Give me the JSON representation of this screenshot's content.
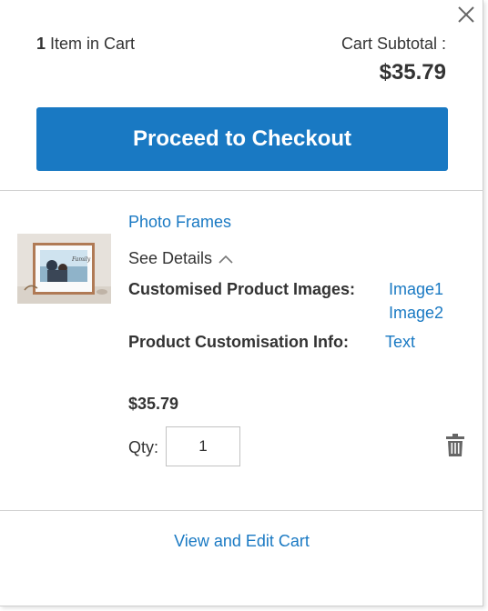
{
  "minicart": {
    "close_icon": "close-icon",
    "items_count": "1",
    "items_label": "Item in Cart",
    "subtotal_label": "Cart Subtotal :",
    "subtotal_amount": "$35.79",
    "checkout_label": "Proceed to Checkout",
    "view_cart_label": "View and Edit Cart",
    "accent_color": "#1979c3"
  },
  "product": {
    "name": "Photo Frames",
    "image_alt": "Photo frame product thumbnail",
    "image_text": "Family",
    "see_details_label": "See Details",
    "see_details_icon": "chevron-up-icon",
    "options": [
      {
        "label": "Customised Product Images:",
        "values": [
          "Image1",
          "Image2"
        ]
      },
      {
        "label": "Product Customisation Info:",
        "values": [
          "Text"
        ]
      }
    ],
    "price": "$35.79",
    "qty_label": "Qty:",
    "qty_value": "1",
    "delete_icon": "trash-icon"
  }
}
